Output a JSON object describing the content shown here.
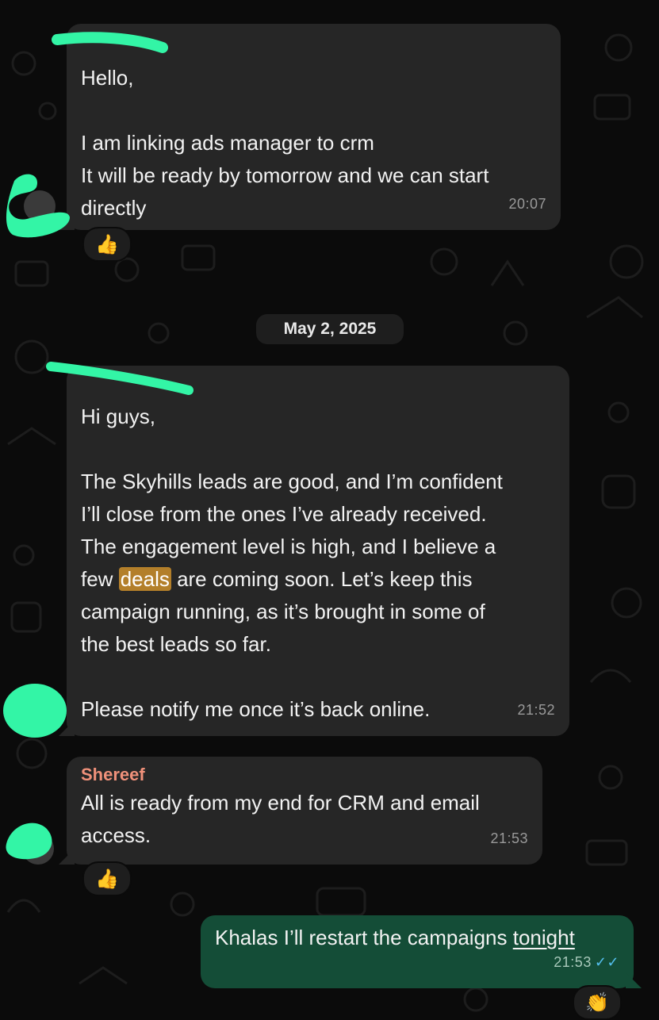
{
  "chat": {
    "messages": [
      {
        "sender": "",
        "lines": [
          "Hello,",
          "",
          "I am linking ads manager to crm",
          "It will be ready by tomorrow and we can start",
          "directly"
        ],
        "time": "20:07",
        "reaction": "👍"
      },
      {
        "sender": "",
        "line1": "Hi guys,",
        "line3": "The Skyhills leads are good, and I’m confident",
        "line4": "I’ll close from the ones I’ve already received.",
        "line5": "The engagement level is high, and I believe a",
        "line6_before": "few ",
        "line6_highlight": "deals",
        "line6_after": " are coming soon. Let’s keep this",
        "line7": "campaign running, as it’s brought in some of",
        "line8": "the best leads so far.",
        "line10": "Please notify me once it’s back online.",
        "time": "21:52"
      },
      {
        "sender": "Shereef",
        "lines": [
          "All is ready from my end for CRM and email",
          "access."
        ],
        "time": "21:53",
        "reaction": "👍"
      },
      {
        "text_before": "Khalas I’ll restart the campaigns ",
        "text_underlined": "tonight",
        "time": "21:53",
        "status": "✓✓",
        "reaction": "👏"
      }
    ],
    "date_separator": "May 2, 2025"
  },
  "colors": {
    "background": "#0b0b0b",
    "incoming_bubble": "#262626",
    "outgoing_bubble": "#144d37",
    "sender_shereef": "#f0917a",
    "sender_teal": "#4fb3a9",
    "highlight": "#b37f2a",
    "read_ticks": "#53bdeb",
    "redaction": "#33f5a6"
  },
  "icons": [
    "thumbs-up-icon",
    "clapping-hands-icon",
    "read-receipt-icon"
  ]
}
